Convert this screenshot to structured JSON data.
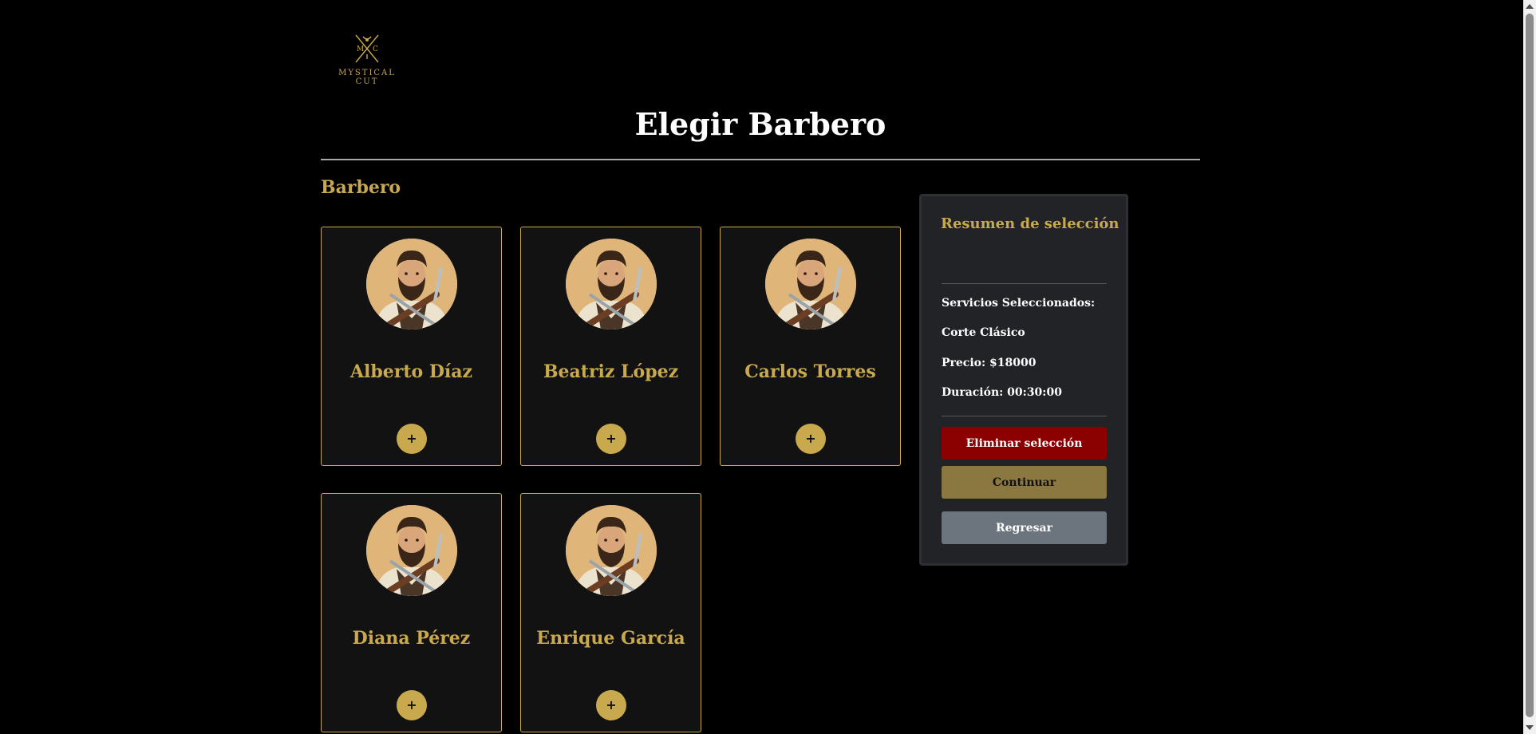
{
  "brand": {
    "logo_initials_left": "M",
    "logo_initials_right": "C",
    "logo_line1": "MYSTICAL",
    "logo_line2": "CUT"
  },
  "page": {
    "title": "Elegir Barbero",
    "section_title": "Barbero"
  },
  "barbers": [
    {
      "name": "Alberto Díaz",
      "add_label": "+"
    },
    {
      "name": "Beatriz López",
      "add_label": "+"
    },
    {
      "name": "Carlos Torres",
      "add_label": "+"
    },
    {
      "name": "Diana Pérez",
      "add_label": "+"
    },
    {
      "name": "Enrique García",
      "add_label": "+"
    }
  ],
  "summary": {
    "title": "Resumen de selección",
    "services_label": "Servicios Seleccionados:",
    "service_name": "Corte Clásico",
    "price": "Precio: $18000",
    "duration": "Duración: 00:30:00",
    "remove_label": "Eliminar selección",
    "continue_label": "Continuar",
    "back_label": "Regresar"
  },
  "colors": {
    "accent_gold": "#c9a94e",
    "danger": "#8b0000",
    "continue": "#8a7840",
    "secondary": "#6c757d",
    "panel": "#212326",
    "card": "#121212"
  },
  "icons": {
    "logo": "crossed-scissors-razor-logo",
    "avatar": "barber-portrait",
    "add": "plus-icon"
  }
}
